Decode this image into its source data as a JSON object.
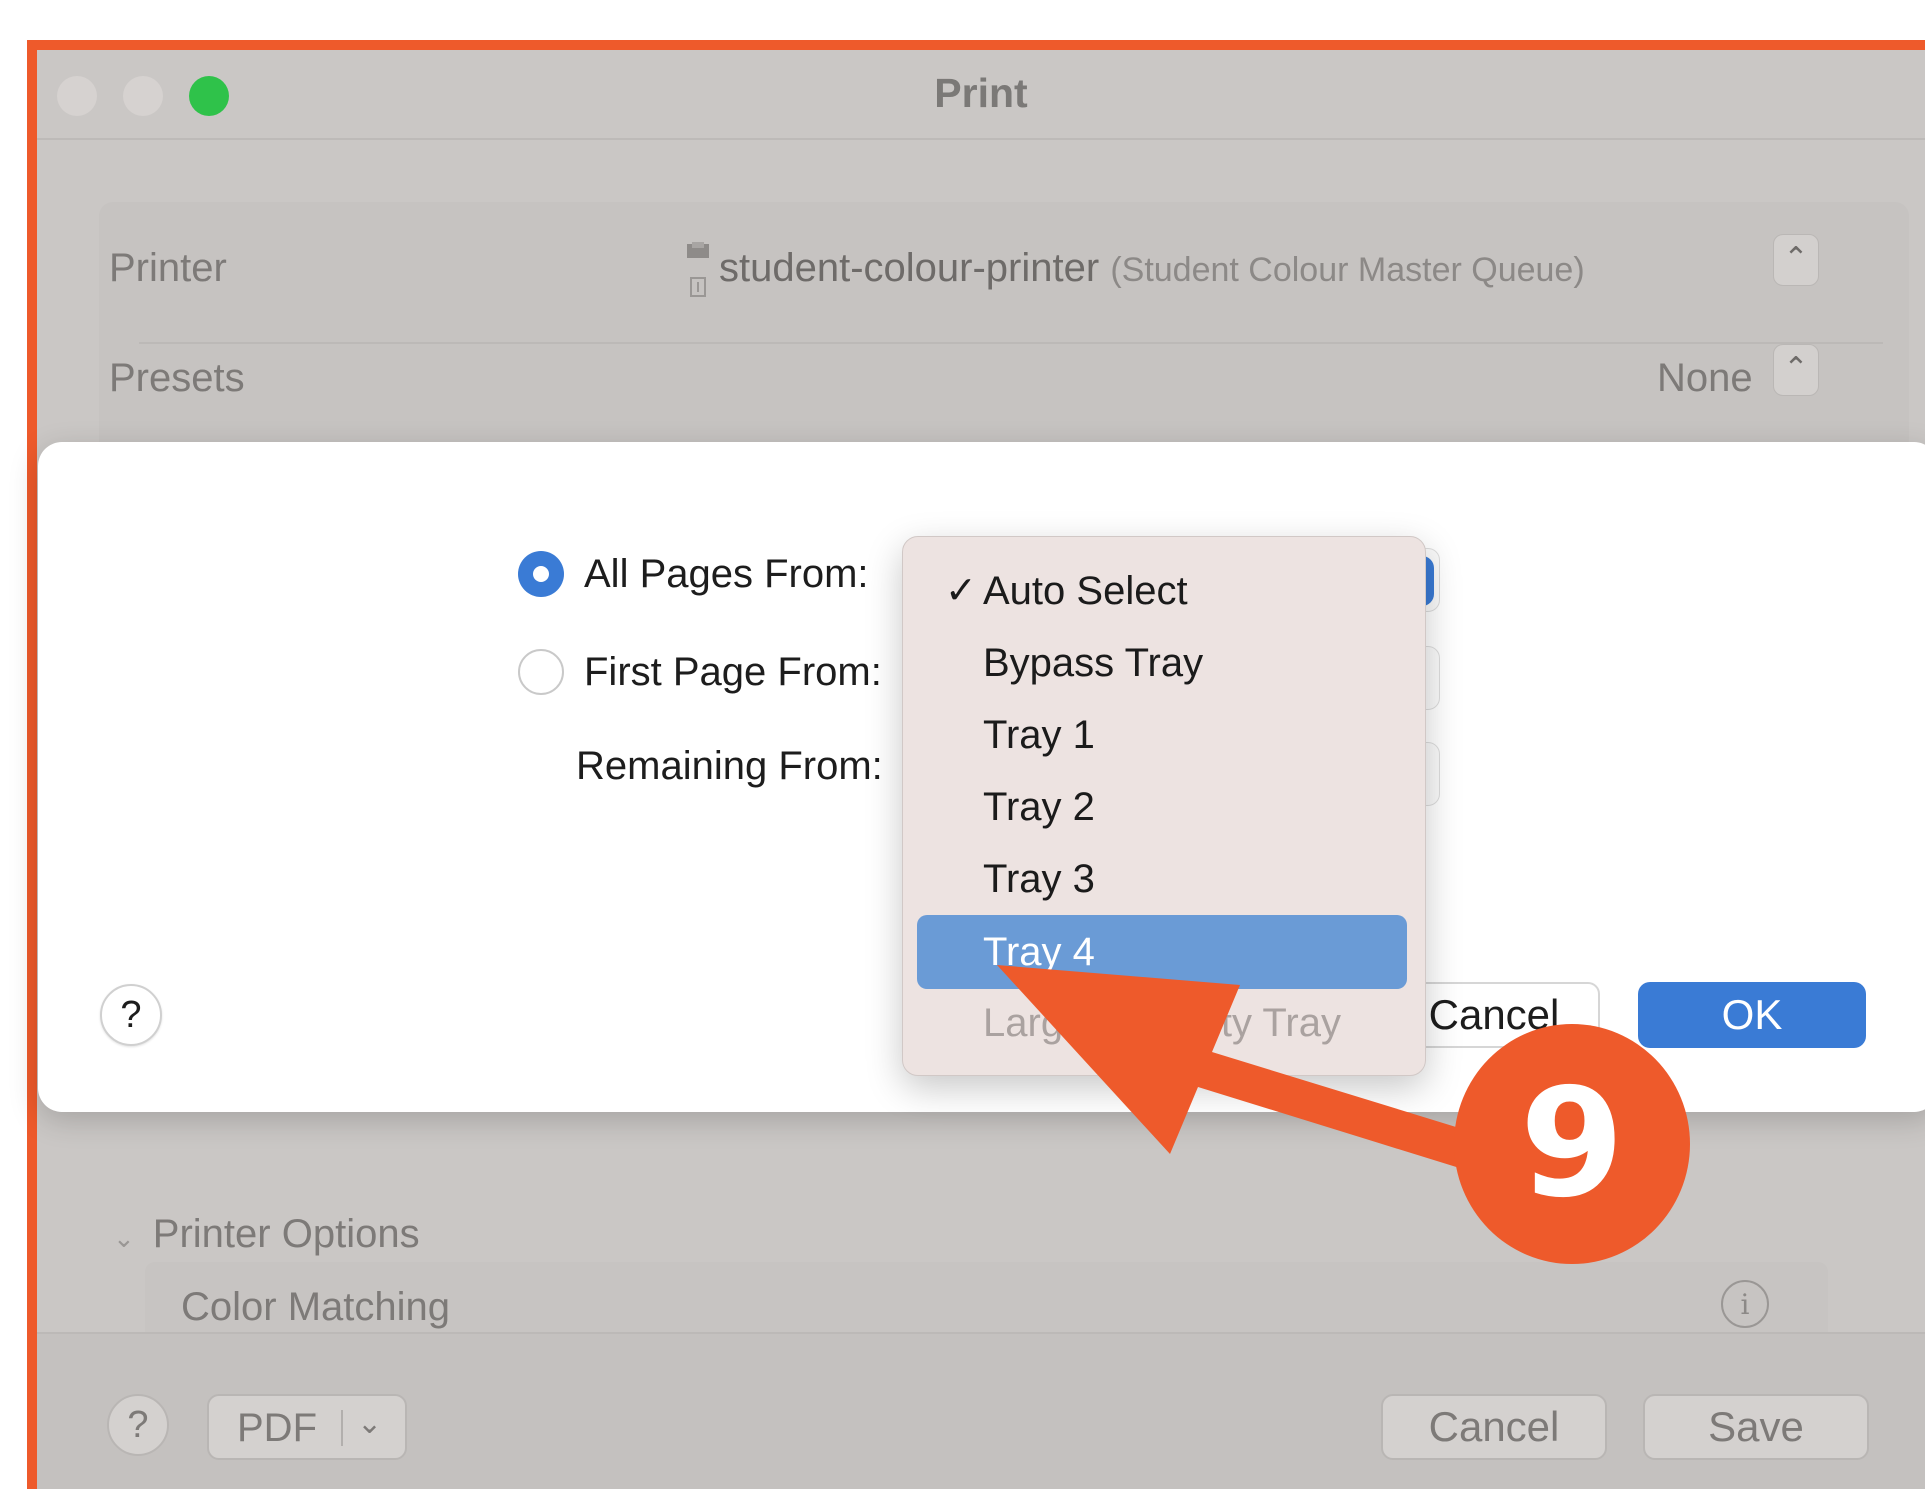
{
  "window": {
    "title": "Print"
  },
  "printer": {
    "label": "Printer",
    "name": "student-colour-printer",
    "queue": "(Student Colour Master Queue)"
  },
  "presets": {
    "label": "Presets",
    "value": "None"
  },
  "sheet": {
    "all_pages_label": "All Pages From:",
    "first_page_label": "First Page From:",
    "remaining_label": "Remaining From:",
    "help": "?",
    "cancel": "Cancel",
    "ok": "OK",
    "selected_option": "all_pages"
  },
  "menu": {
    "items": [
      {
        "label": "Auto Select",
        "checked": true
      },
      {
        "label": "Bypass Tray"
      },
      {
        "label": "Tray 1"
      },
      {
        "label": "Tray 2"
      },
      {
        "label": "Tray 3"
      },
      {
        "label": "Tray 4",
        "highlighted": true
      },
      {
        "label": "Large Capacity Tray",
        "disabled": true
      }
    ],
    "checkmark": "✓"
  },
  "lower": {
    "printer_options": "Printer Options",
    "color_matching": "Color Matching",
    "info_glyph": "i"
  },
  "bottom": {
    "help": "?",
    "pdf": "PDF",
    "cancel": "Cancel",
    "save": "Save"
  },
  "annotation": {
    "step": "9",
    "color": "#ee5a2b"
  },
  "colors": {
    "accent": "#3a7bd5",
    "menu_highlight": "#6a9bd6",
    "maximize": "#2fc24a"
  }
}
